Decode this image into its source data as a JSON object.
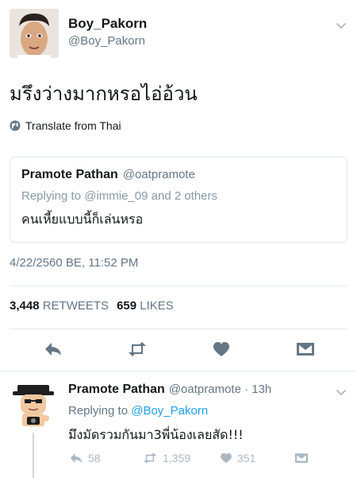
{
  "tweet": {
    "display_name": "Boy_Pakorn",
    "handle": "@Boy_Pakorn",
    "text": "มรึงว่างมากหรอไอ่อ้วน",
    "translate_label": "Translate from Thai",
    "timestamp": "4/22/2560 BE, 11:52 PM",
    "retweets_count": "3,448",
    "retweets_label": "RETWEETS",
    "likes_count": "659",
    "likes_label": "LIKES"
  },
  "quoted": {
    "display_name": "Pramote Pathan",
    "handle": "@oatpramote",
    "replying": "Replying to @immie_09 and 2 others",
    "text": "คนเหี้ยแบบนี้ก็เล่นหรอ"
  },
  "reply": {
    "display_name": "Pramote Pathan",
    "meta": "@oatpramote · 13h",
    "replying_prefix": "Replying to",
    "replying_mention": "@Boy_Pakorn",
    "text": "มึงมัดรวมกันมา3พี่น้องเลยสัด!!!",
    "replies": "58",
    "retweets": "1,359",
    "likes": "351"
  },
  "colors": {
    "text": "#14171a",
    "secondary": "#657786",
    "link": "#1da1f2",
    "action_main": "#657786",
    "action_light": "#aab8c2",
    "border": "#e1e8ed"
  },
  "icons": [
    "chevron-down-icon",
    "globe-icon",
    "reply-icon",
    "retweet-icon",
    "heart-icon",
    "message-icon"
  ]
}
